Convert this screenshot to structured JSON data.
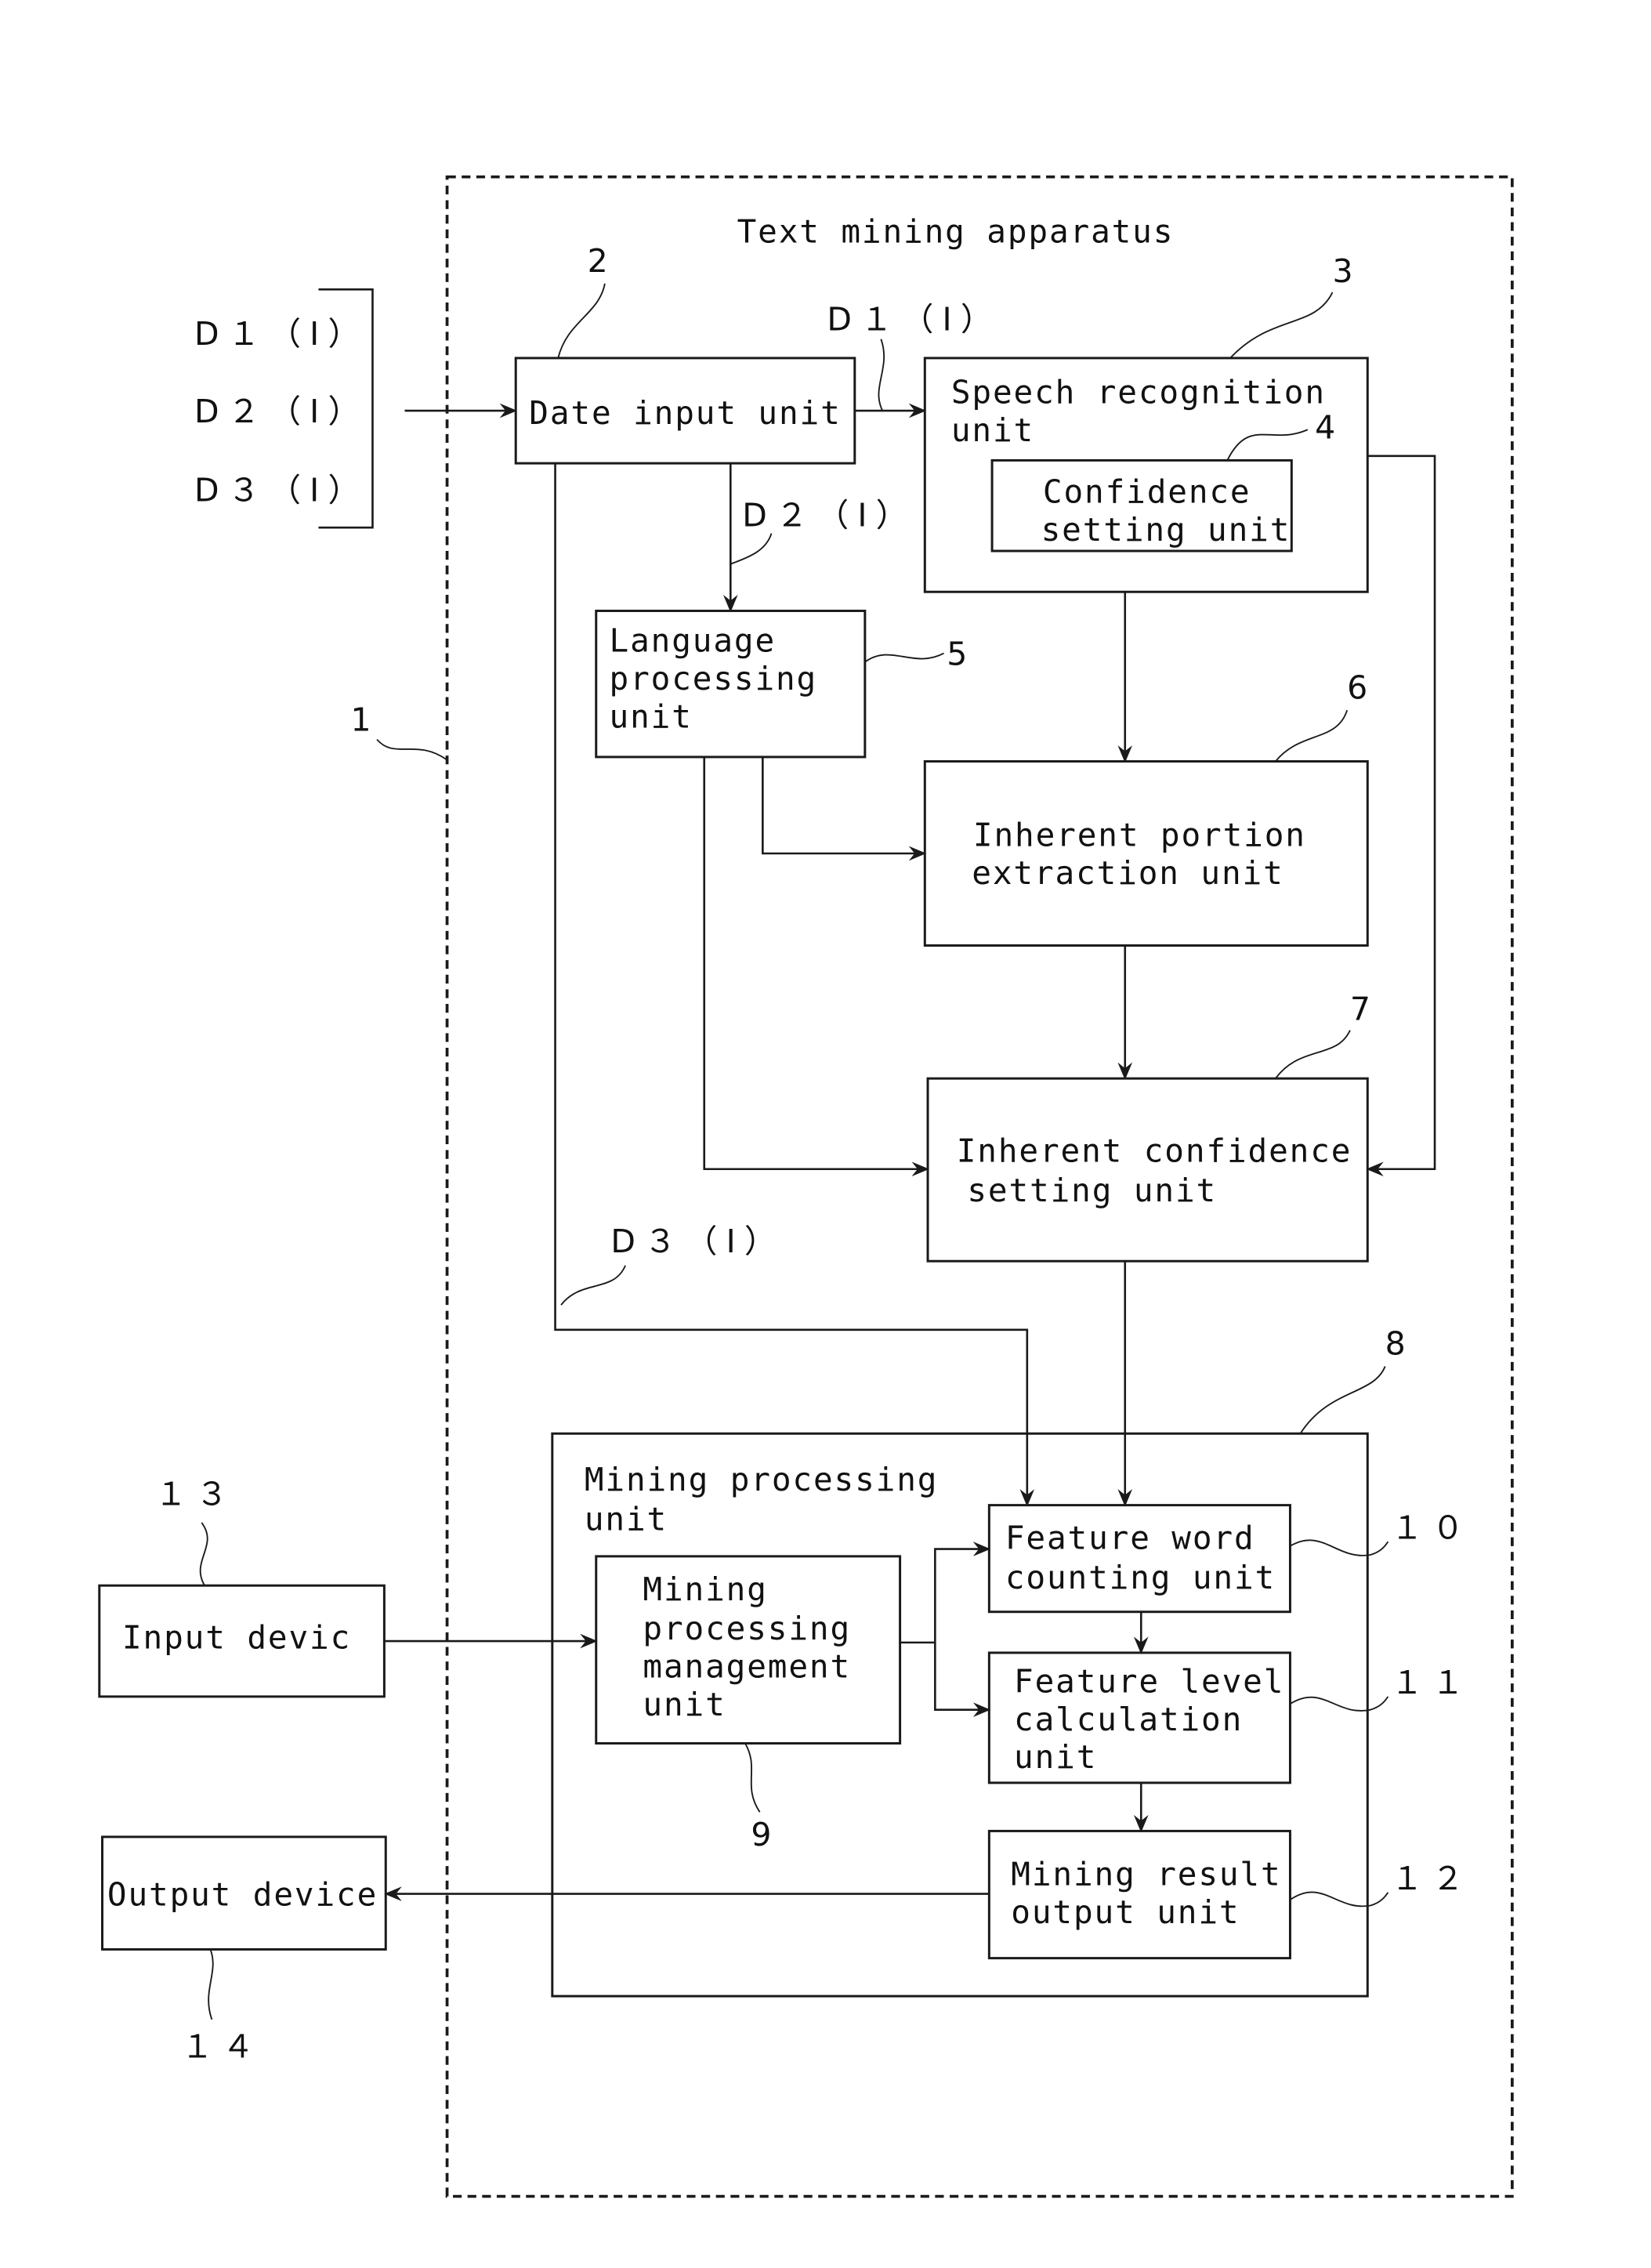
{
  "figure": {
    "title": "Text mining apparatus",
    "apparatus_ref": "1"
  },
  "inputs": {
    "d1": "D１（I）",
    "d2": "D２（I）",
    "d3": "D３（I）"
  },
  "flow_labels": {
    "d1": "D１（I）",
    "d2": "D２（I）",
    "d3": "D３（I）"
  },
  "units": {
    "date_input": {
      "ref": "2",
      "lines": [
        "Date input unit"
      ]
    },
    "speech_recognition": {
      "ref": "3",
      "lines": [
        "Speech recognition",
        "unit"
      ]
    },
    "confidence_setting": {
      "ref": "4",
      "lines": [
        "Confidence",
        "setting unit"
      ]
    },
    "language_processing": {
      "ref": "5",
      "lines": [
        "Language",
        "processing",
        "unit"
      ]
    },
    "inherent_portion_extraction": {
      "ref": "6",
      "lines": [
        "Inherent portion",
        "extraction unit"
      ]
    },
    "inherent_confidence_setting": {
      "ref": "7",
      "lines": [
        "Inherent confidence",
        "setting unit"
      ]
    },
    "mining_processing": {
      "ref": "8",
      "lines": [
        "Mining processing",
        "unit"
      ]
    },
    "mining_processing_management": {
      "ref": "9",
      "lines": [
        "Mining",
        "processing",
        "management",
        "unit"
      ]
    },
    "feature_word_counting": {
      "ref": "１０",
      "lines": [
        "Feature word",
        "counting unit"
      ]
    },
    "feature_level_calculation": {
      "ref": "１１",
      "lines": [
        "Feature level",
        "calculation",
        "unit"
      ]
    },
    "mining_result_output": {
      "ref": "１２",
      "lines": [
        "Mining result",
        "output unit"
      ]
    },
    "input_device": {
      "ref": "１３",
      "lines": [
        "Input devic"
      ]
    },
    "output_device": {
      "ref": "１４",
      "lines": [
        "Output device"
      ]
    }
  }
}
